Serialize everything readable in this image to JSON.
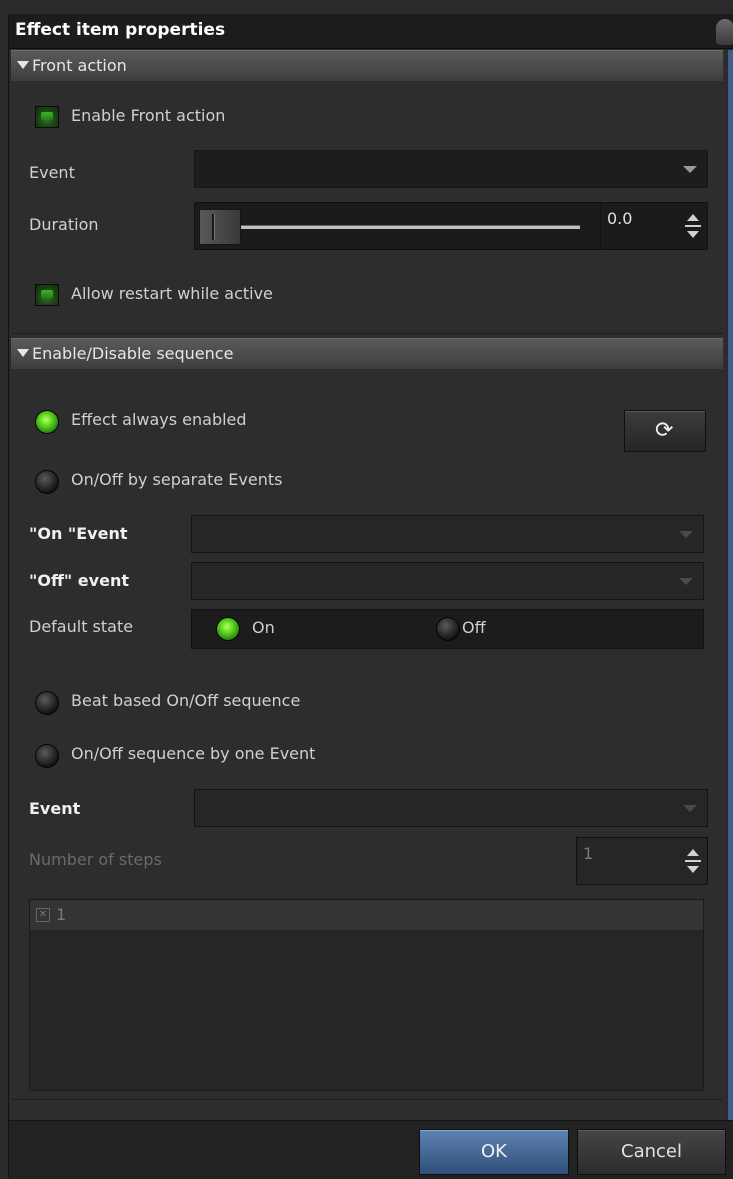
{
  "window": {
    "title": "Effect item properties"
  },
  "front_action": {
    "header": "Front action",
    "enable_label": "Enable Front action",
    "event_label": "Event",
    "event_value": "",
    "duration_label": "Duration",
    "duration_value": "0.0",
    "allow_restart_label": "Allow restart while active"
  },
  "sequence": {
    "header": "Enable/Disable sequence",
    "always_enabled_label": "Effect always enabled",
    "separate_events_label": "On/Off by separate Events",
    "on_event_label": "\"On \"Event",
    "on_event_value": "",
    "off_event_label": "\"Off\" event",
    "off_event_value": "",
    "default_state_label": "Default state",
    "default_on_label": "On",
    "default_off_label": "Off",
    "beat_based_label": "Beat based On/Off sequence",
    "one_event_label": "On/Off sequence by one Event",
    "event_label": "Event",
    "event_value": "",
    "steps_label": "Number of steps",
    "steps_value": "1",
    "steps_list": [
      {
        "label": "1"
      }
    ]
  },
  "footer": {
    "ok_label": "OK",
    "cancel_label": "Cancel"
  },
  "colors": {
    "accent_blue": "#3f5f8f",
    "active_green": "#5cd41e",
    "background": "#2d2d2d"
  },
  "icons": {
    "refresh": "refresh-icon",
    "collapse": "triangle-down-icon",
    "checkbox_x": "checkbox-x-icon"
  }
}
